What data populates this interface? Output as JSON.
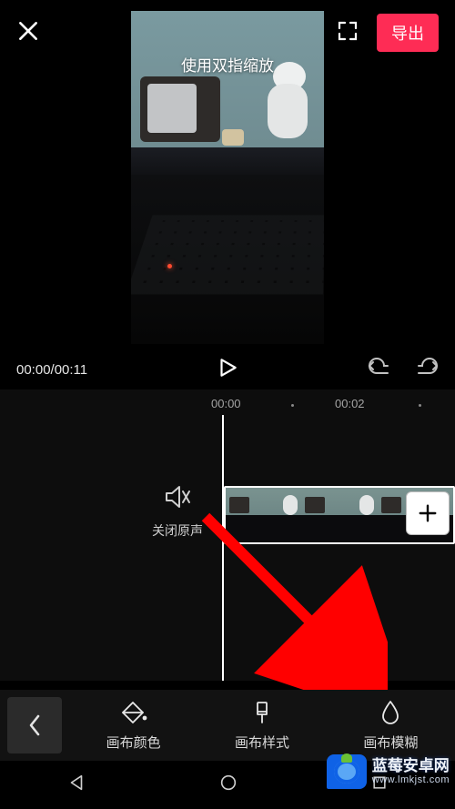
{
  "header": {
    "export_label": "导出"
  },
  "preview": {
    "hint": "使用双指缩放"
  },
  "playback": {
    "time": "00:00/00:11"
  },
  "timeline": {
    "ruler": {
      "t0": "00:00",
      "t1": "00:02"
    },
    "mute_label": "关闭原声"
  },
  "tools": {
    "item1": "画布颜色",
    "item2": "画布样式",
    "item3": "画布模糊"
  },
  "watermark": {
    "main": "蓝莓安卓网",
    "sub": "www.lmkjst.com"
  }
}
